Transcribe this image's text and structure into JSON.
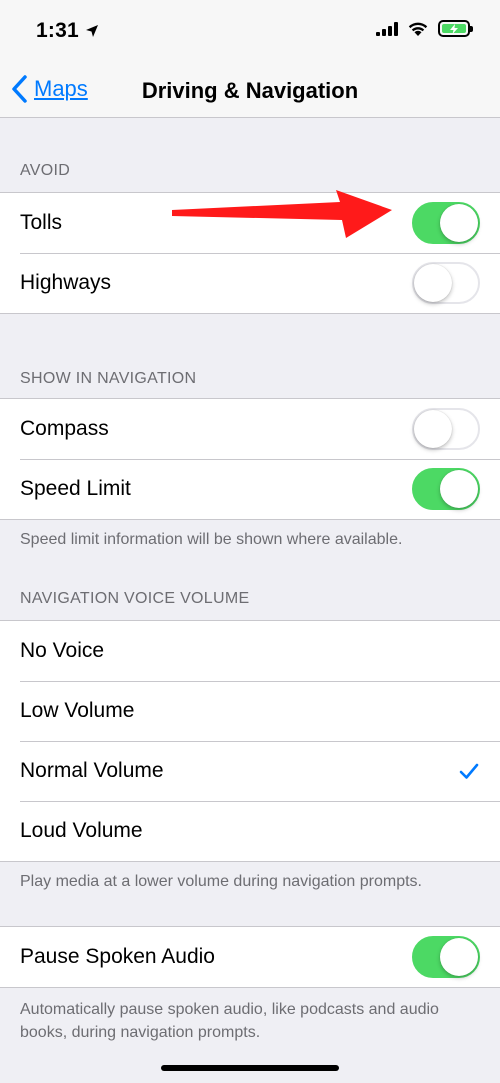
{
  "status": {
    "time": "1:31"
  },
  "nav": {
    "back_label": "Maps",
    "title": "Driving & Navigation"
  },
  "avoid": {
    "header": "AVOID",
    "rows": [
      {
        "label": "Tolls",
        "on": true
      },
      {
        "label": "Highways",
        "on": false
      }
    ]
  },
  "show_in_navigation": {
    "header": "SHOW IN NAVIGATION",
    "rows": [
      {
        "label": "Compass",
        "on": false
      },
      {
        "label": "Speed Limit",
        "on": true
      }
    ],
    "footer": "Speed limit information will be shown where available."
  },
  "voice_volume": {
    "header": "NAVIGATION VOICE VOLUME",
    "options": [
      {
        "label": "No Voice",
        "selected": false
      },
      {
        "label": "Low Volume",
        "selected": false
      },
      {
        "label": "Normal Volume",
        "selected": true
      },
      {
        "label": "Loud Volume",
        "selected": false
      }
    ],
    "footer": "Play media at a lower volume during navigation prompts."
  },
  "pause_audio": {
    "label": "Pause Spoken Audio",
    "on": true,
    "footer": "Automatically pause spoken audio, like podcasts and audio books, during navigation prompts."
  },
  "colors": {
    "accent": "#007aff",
    "toggle_on": "#4cd964",
    "annotation_arrow": "#ff1a1a",
    "background": "#efeff4"
  },
  "icons": {
    "back": "chevron-left-icon",
    "location": "location-arrow-icon",
    "signal": "cellular-signal-icon",
    "wifi": "wifi-icon",
    "battery": "battery-charging-icon",
    "check": "checkmark-icon"
  }
}
